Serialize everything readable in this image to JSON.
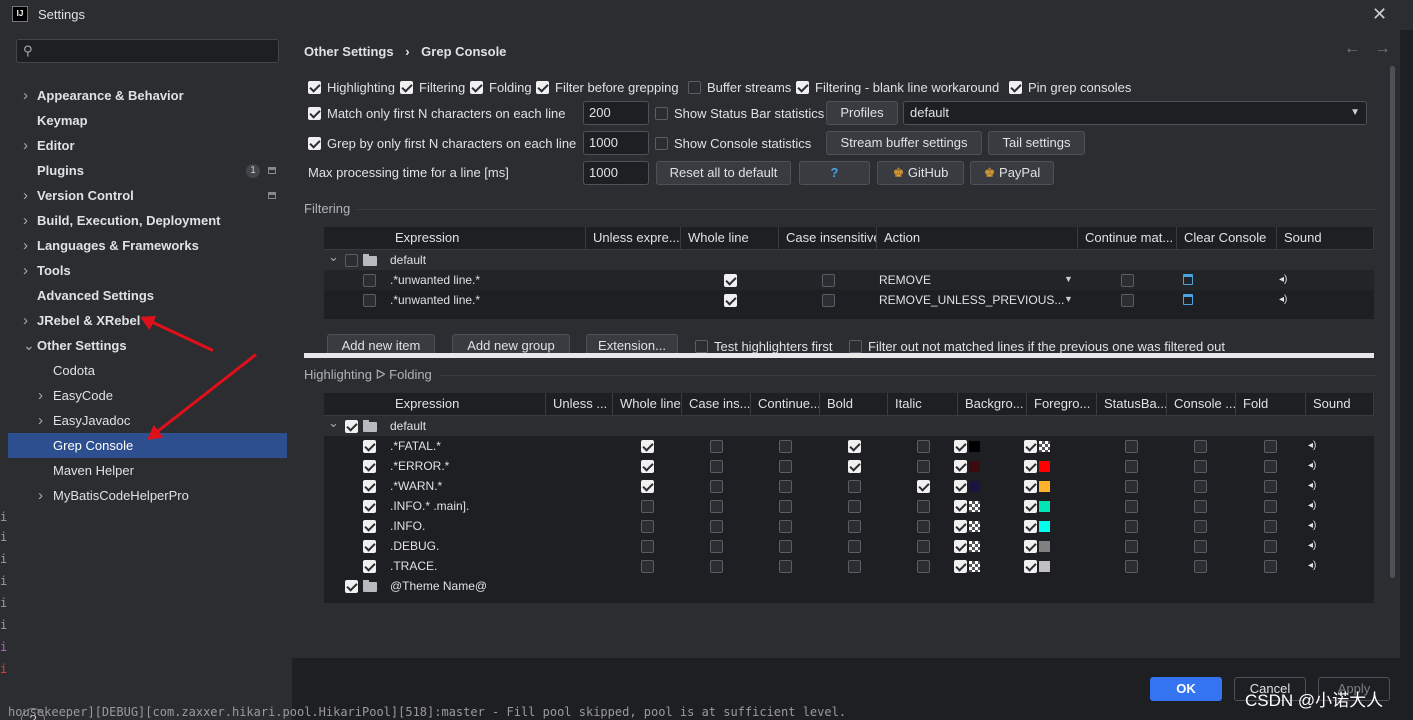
{
  "window": {
    "title": "Settings",
    "close": "✕",
    "logo": "IJ"
  },
  "sidebar": {
    "search_icon": "search-icon",
    "items": [
      {
        "label": "Appearance & Behavior",
        "bold": true,
        "expandable": true
      },
      {
        "label": "Keymap",
        "bold": true,
        "expandable": false
      },
      {
        "label": "Editor",
        "bold": true,
        "expandable": true
      },
      {
        "label": "Plugins",
        "bold": true,
        "expandable": false,
        "badge": "1"
      },
      {
        "label": "Version Control",
        "bold": true,
        "expandable": true
      },
      {
        "label": "Build, Execution, Deployment",
        "bold": true,
        "expandable": true
      },
      {
        "label": "Languages & Frameworks",
        "bold": true,
        "expandable": true
      },
      {
        "label": "Tools",
        "bold": true,
        "expandable": true
      },
      {
        "label": "Advanced Settings",
        "bold": true,
        "expandable": false
      },
      {
        "label": "JRebel & XRebel",
        "bold": true,
        "expandable": true
      },
      {
        "label": "Other Settings",
        "bold": true,
        "expanded": true
      },
      {
        "label": "Codota",
        "child": true
      },
      {
        "label": "EasyCode",
        "child": true,
        "expandable": true
      },
      {
        "label": "EasyJavadoc",
        "child": true,
        "expandable": true
      },
      {
        "label": "Grep Console",
        "child": true,
        "selected": true
      },
      {
        "label": "Maven Helper",
        "child": true
      },
      {
        "label": "MyBatisCodeHelperPro",
        "child": true,
        "expandable": true
      }
    ],
    "help": "?"
  },
  "breadcrumb": {
    "parent": "Other Settings",
    "sep": "›",
    "current": "Grep Console",
    "back": "←",
    "forward": "→"
  },
  "options": {
    "highlighting": "Highlighting",
    "filtering": "Filtering",
    "folding": "Folding",
    "filter_before": "Filter before grepping",
    "buffer_streams": "Buffer streams",
    "filtering_blank": "Filtering - blank line workaround",
    "pin": "Pin grep consoles",
    "match_first": "Match only first N characters on each line",
    "match_first_value": "200",
    "show_status": "Show Status Bar statistics",
    "profiles": "Profiles",
    "profile_value": "default",
    "grep_first": "Grep by only first N characters on each line",
    "grep_first_value": "1000",
    "show_console": "Show Console statistics",
    "stream_buffer": "Stream buffer settings",
    "tail": "Tail settings",
    "max_time": "Max processing time for a line [ms]",
    "max_time_value": "1000",
    "reset": "Reset all to default",
    "help_q": "?",
    "github": "GitHub",
    "paypal": "PayPal"
  },
  "filtering": {
    "title": "Filtering",
    "headers": [
      "Expression",
      "Unless expre...",
      "Whole line",
      "Case insensitive",
      "Action",
      "Continue mat...",
      "Clear Console",
      "Sound"
    ],
    "group": "default",
    "rows": [
      {
        "expr": ".*unwanted line.*",
        "action": "REMOVE"
      },
      {
        "expr": ".*unwanted line.*",
        "action": "REMOVE_UNLESS_PREVIOUS..."
      }
    ],
    "buttons": {
      "add_item": "Add new item",
      "add_group": "Add new group",
      "extension": "Extension...",
      "test_first": "Test highlighters first",
      "filter_out": "Filter out not matched lines if the previous one was filtered out"
    }
  },
  "highlighting": {
    "title": "Highlighting ᐅ Folding",
    "headers": [
      "Expression",
      "Unless ...",
      "Whole line",
      "Case ins...",
      "Continue...",
      "Bold",
      "Italic",
      "Backgro...",
      "Foregro...",
      "StatusBa...",
      "Console ...",
      "Fold",
      "Sound"
    ],
    "group": "default",
    "rows": [
      {
        "expr": ".*FATAL.*",
        "whole": true,
        "bold": true,
        "italic": false,
        "bg": "#000000",
        "fg": "checker"
      },
      {
        "expr": ".*ERROR.*",
        "whole": true,
        "bold": true,
        "italic": false,
        "bg": "#3a0c12",
        "fg": "#ff0000"
      },
      {
        "expr": ".*WARN.*",
        "whole": true,
        "bold": false,
        "italic": true,
        "bg": "#1c1440",
        "fg": "#ffb22c"
      },
      {
        "expr": ".INFO.* .main].",
        "whole": false,
        "bold": false,
        "italic": false,
        "bg": "checker",
        "fg": "#00e5b5"
      },
      {
        "expr": ".INFO.",
        "whole": false,
        "bold": false,
        "italic": false,
        "bg": "checker",
        "fg": "#00ffee"
      },
      {
        "expr": ".DEBUG.",
        "whole": false,
        "bold": false,
        "italic": false,
        "bg": "checker",
        "fg": "#808080"
      },
      {
        "expr": ".TRACE.",
        "whole": false,
        "bold": false,
        "italic": false,
        "bg": "checker",
        "fg": "#c0c0c0"
      }
    ],
    "theme_row": "@Theme Name@"
  },
  "footer": {
    "ok": "OK",
    "cancel": "Cancel",
    "apply": "Apply"
  },
  "watermark": "CSDN @小诺大人",
  "console_line": "housekeeper][DEBUG][com.zaxxer.hikari.pool.HikariPool][518]:master - Fill pool skipped, pool is at sufficient level."
}
